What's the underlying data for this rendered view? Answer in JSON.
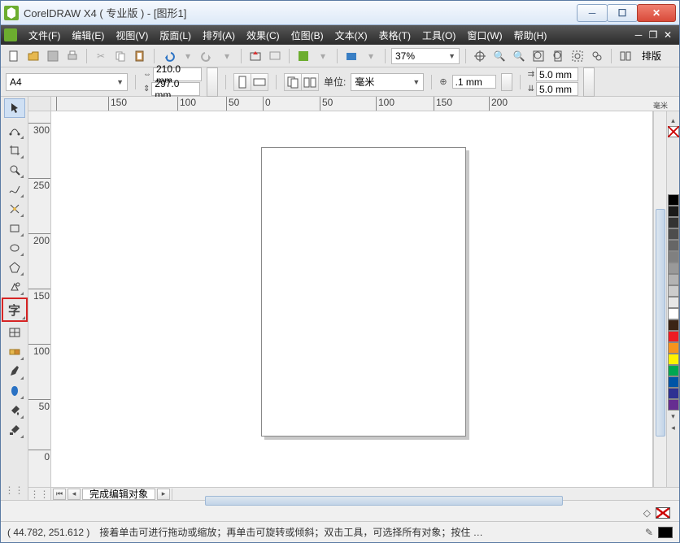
{
  "title": "CorelDRAW X4 ( 专业版 ) - [图形1]",
  "menu": [
    "文件(F)",
    "编辑(E)",
    "视图(V)",
    "版面(L)",
    "排列(A)",
    "效果(C)",
    "位图(B)",
    "文本(X)",
    "表格(T)",
    "工具(O)",
    "窗口(W)",
    "帮助(H)"
  ],
  "toolbar": {
    "zoom": "37%",
    "排版": "排版"
  },
  "prop": {
    "paper": "A4",
    "width": "210.0 mm",
    "height": "297.0 mm",
    "unit_label": "单位:",
    "unit": "毫米",
    "nudge": ".1 mm",
    "dupx": "5.0 mm",
    "dupy": "5.0 mm"
  },
  "hruler": [
    "",
    "150",
    "100",
    "50",
    "0",
    "50",
    "100",
    "150",
    "200"
  ],
  "hruler_unit": "毫米",
  "vruler": [
    "300",
    "250",
    "200",
    "150",
    "100",
    "50",
    "0"
  ],
  "pager_tab": "完成编辑对象",
  "status": {
    "coords": "( 44.782, 251.612 )",
    "hint": "接着单击可进行拖动或缩放；再单击可旋转或倾斜；双击工具，可选择所有对象；按住 …"
  },
  "tools": [
    "pick",
    "shape",
    "crop",
    "zoom",
    "freehand",
    "smart",
    "rectangle",
    "ellipse",
    "polygon",
    "basic-shapes",
    "text",
    "table",
    "dimension",
    "interactive",
    "dropper",
    "outline",
    "fill",
    "interactive-fill"
  ],
  "palette": [
    "#000000",
    "#FFFFFF",
    "#1A1A1A",
    "#00A5E3",
    "#0047AB",
    "#2E3192",
    "#662D91",
    "#92278F",
    "#EC008C",
    "#ED1C24",
    "#F26522",
    "#F7941D",
    "#FFF200",
    "#8DC63F",
    "#00A651",
    "#00A99D",
    "#808080",
    "#C0C0C0",
    "#603913"
  ]
}
